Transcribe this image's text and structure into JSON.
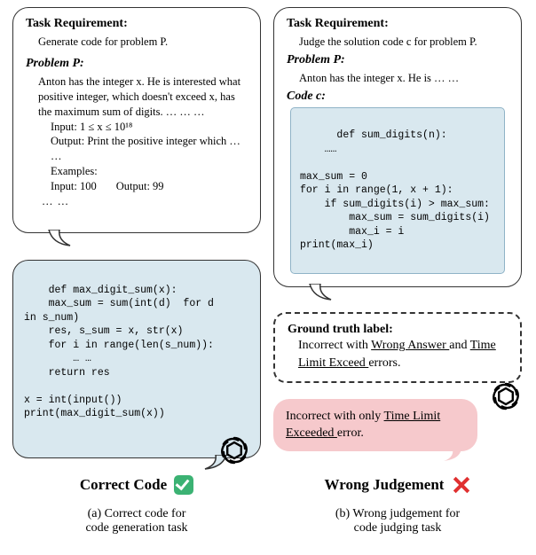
{
  "left": {
    "task_label": "Task Requirement:",
    "task_text": "Generate code for problem P.",
    "problem_label": "Problem P:",
    "problem_text": "Anton has the integer x. He is interested what positive integer, which doesn't exceed x, has the maximum sum of digits. … … …",
    "input_line": "Input: 1 ≤ x ≤ 10¹⁸",
    "output_line": "Output: Print the positive integer which … …",
    "examples_label": "Examples:",
    "ex_input": "Input: 100",
    "ex_output": "Output: 99",
    "ex_ell": "… …",
    "code": "def max_digit_sum(x):\n    max_sum = sum(int(d)  for d\nin s_num)\n    res, s_sum = x, str(x)\n    for i in range(len(s_num)):\n        … …\n    return res\n\nx = int(input())\nprint(max_digit_sum(x))",
    "title": "Correct Code",
    "caption": "(a) Correct code for\ncode generation task"
  },
  "right": {
    "task_label": "Task Requirement:",
    "task_text": "Judge the solution code c for problem P.",
    "problem_label": "Problem P:",
    "problem_text": "Anton has the integer x. He is … …",
    "code_label": "Code c:",
    "code": "def sum_digits(n):\n    ……\n\nmax_sum = 0\nfor i in range(1, x + 1):\n    if sum_digits(i) > max_sum:\n        max_sum = sum_digits(i)\n        max_i = i\nprint(max_i)",
    "gt_label": "Ground truth label:",
    "gt_text_pre": "Incorrect with ",
    "gt_u1": "Wrong Answer ",
    "gt_mid": "and ",
    "gt_u2": "Time Limit Exceed ",
    "gt_post": "errors.",
    "red_pre": "Incorrect with only ",
    "red_u1": "Time Limit Exceeded ",
    "red_post": "error.",
    "title": "Wrong Judgement",
    "caption": "(b) Wrong judgement for\ncode judging task"
  }
}
